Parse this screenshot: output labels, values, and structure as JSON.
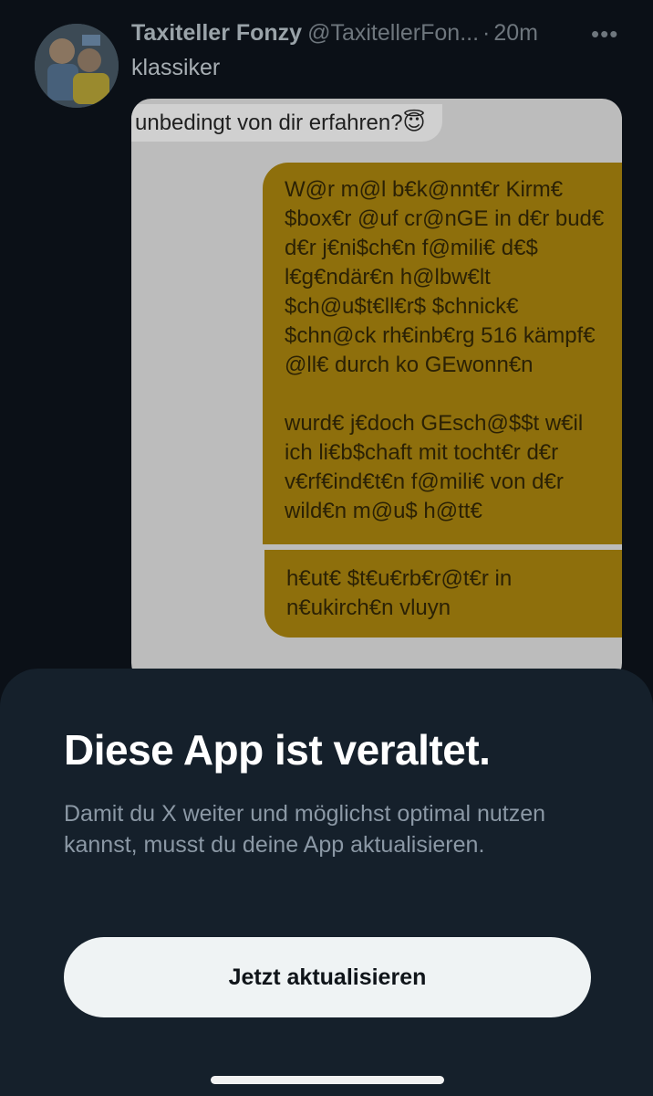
{
  "tweet": {
    "author_name": "Taxiteller Fonzy",
    "handle": "@TaxitellerFon...",
    "separator": "·",
    "time": "20m",
    "more_icon": "more-horizontal-icon",
    "text": "klassiker"
  },
  "media": {
    "incoming_message": "unbedingt von dir erfahren?😇",
    "outgoing_messages": [
      "W@r m@l b€k@nnt€r Kirm€ $box€r @uf cr@nGE in d€r bud€ d€r j€ni$ch€n f@mili€ d€$ l€g€ndär€n h@lbw€lt $ch@u$t€ll€r$ $chnick€ $chn@ck rh€inb€rg 516 kämpf€ @ll€ durch ko GEwonn€n\n\nwurd€ j€doch GEsch@$$t w€il ich li€b$chaft mit tocht€r d€r v€rf€ind€t€n f@mili€ von d€r wild€n m@u$ h@tt€",
      "h€ut€ $t€u€rb€r@t€r in n€ukirch€n vluyn"
    ],
    "outgoing_color": "#8e6f0c"
  },
  "update_sheet": {
    "title": "Diese App ist veraltet.",
    "body": "Damit du X weiter und möglichst optimal nutzen kannst, musst du deine App aktualisieren.",
    "button_label": "Jetzt aktualisieren"
  },
  "colors": {
    "sheet_background": "#15202b",
    "page_background": "#0b1017",
    "button_background": "#eff3f4"
  }
}
